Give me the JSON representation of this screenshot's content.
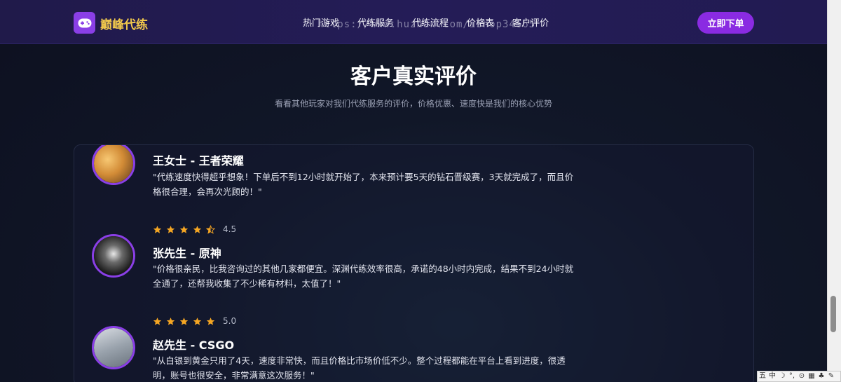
{
  "brand": {
    "name": "巅峰代练"
  },
  "nav": {
    "items": [
      {
        "label": "热门游戏"
      },
      {
        "label": "代练服务"
      },
      {
        "label": "代练流程"
      },
      {
        "label": "价格表"
      },
      {
        "label": "客户评价"
      }
    ],
    "order_label": "立即下单"
  },
  "watermark": "https://www.huzhan.com/ishop34665",
  "section": {
    "title": "客户真实评价",
    "subtitle": "看看其他玩家对我们代练服务的评价，价格优惠、速度快是我们的核心优势"
  },
  "reviews": [
    {
      "name": "王女士 - 王者荣耀",
      "text": "\"代练速度快得超乎想象！下单后不到12小时就开始了，本来预计要5天的钻石晋级赛，3天就完成了，而且价格很合理，会再次光顾的！\"",
      "stars": 4.5,
      "rating": "4.5"
    },
    {
      "name": "张先生 - 原神",
      "text": "\"价格很亲民，比我咨询过的其他几家都便宜。深渊代练效率很高，承诺的48小时内完成，结果不到24小时就全通了，还帮我收集了不少稀有材料，太值了！\"",
      "stars": 5.0,
      "rating": "5.0"
    },
    {
      "name": "赵先生 - CSGO",
      "text": "\"从白银到黄金只用了4天，速度非常快，而且价格比市场价低不少。整个过程都能在平台上看到进度，很透明，账号也很安全，非常满意这次服务！\""
    }
  ],
  "ime": {
    "labels": [
      "五",
      "中",
      "☽",
      "°,",
      "⊙",
      "▦",
      "♣",
      "✎"
    ]
  },
  "colors": {
    "accent": "#8a2be2",
    "star": "#f5a623",
    "nav_bg": "#221b52"
  }
}
